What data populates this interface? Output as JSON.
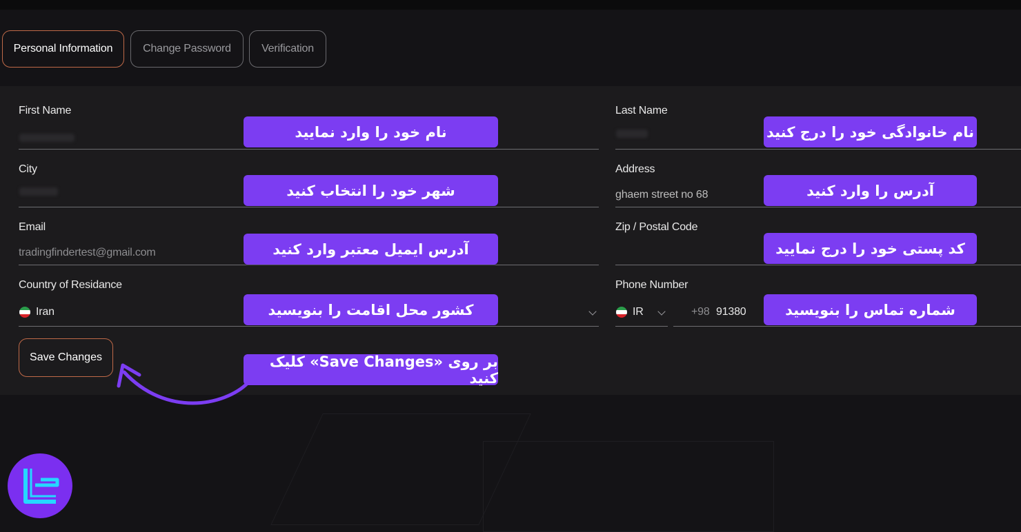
{
  "tabs": [
    {
      "label": "Personal Information",
      "active": true
    },
    {
      "label": "Change Password",
      "active": false
    },
    {
      "label": "Verification",
      "active": false
    }
  ],
  "form": {
    "first_name": {
      "label": "First Name",
      "value": ""
    },
    "last_name": {
      "label": "Last Name",
      "value": ""
    },
    "city": {
      "label": "City",
      "value": ""
    },
    "address": {
      "label": "Address",
      "value": "ghaem street no 68"
    },
    "email": {
      "label": "Email",
      "value": "tradingfindertest@gmail.com"
    },
    "zip": {
      "label": "Zip / Postal Code",
      "value": ""
    },
    "country": {
      "label": "Country of Residance",
      "value": "Iran"
    },
    "phone": {
      "label": "Phone Number",
      "country_code": "IR",
      "dial_code": "+98",
      "number": "91380"
    },
    "save_label": "Save Changes"
  },
  "callouts": {
    "first_name": "نام خود را وارد نمایید",
    "last_name": "نام خانوادگی خود را درج کنید",
    "city": "شهر خود را انتخاب کنید",
    "address": "آدرس را وارد کنید",
    "email": "آدرس ایمیل معتبر وارد کنید",
    "zip": "کد پستی خود را درج نمایید",
    "country": "کشور محل اقامت را بنویسید",
    "phone": "شماره تماس را بنویسید",
    "save": "بر روی «Save Changes» کلیک کنید"
  },
  "colors": {
    "background": "#141316",
    "panel": "#1c1b1d",
    "accent_border": "#c06a48",
    "callout": "#7c3df2",
    "logo": "#7b2ff0",
    "logo_mark": "#25d8ff"
  },
  "icons": [
    "iran-flag-icon",
    "chevron-down-icon",
    "curved-arrow-icon",
    "brand-logo-icon"
  ]
}
